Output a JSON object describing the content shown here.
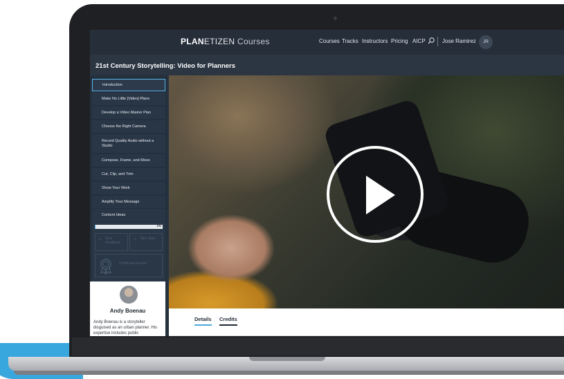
{
  "header": {
    "brand_bold": "PLAN",
    "brand_light": "ETIZEN",
    "brand_suffix": "Courses",
    "nav": [
      "Courses",
      "Tracks",
      "Instructors",
      "Pricing",
      "AICP"
    ],
    "user_name": "Jose Ramirez",
    "user_initials": "JR"
  },
  "course": {
    "title": "21st Century Storytelling: Video for Planners"
  },
  "sidebar": {
    "lessons": [
      "Introduction",
      "Make No Little [Video] Plans",
      "Develop a Video Master Plan",
      "Choose the Right Camera",
      "Record Quality Audio without a Studio",
      "Compose, Frame, and Move",
      "Cut, Clip, and Trim",
      "Show Your Work",
      "Amplify Your Message",
      "Content Ideas"
    ],
    "active_index": 0,
    "progress_percent": 1,
    "progress_label": "1%",
    "feedback_label": "Give Feedback",
    "quiz_label": "Take Quiz",
    "certificate_label": "Certificate Earned"
  },
  "instructor": {
    "name": "Andy Boenau",
    "bio": "Andy Boenau is a storyteller disguised as an urban planner. His expertise includes public"
  },
  "tabs": [
    "Details",
    "Credits"
  ],
  "colors": {
    "accent": "#4aa7de",
    "nav_bg": "#262e3a",
    "sidebar_bg": "#24303e"
  }
}
